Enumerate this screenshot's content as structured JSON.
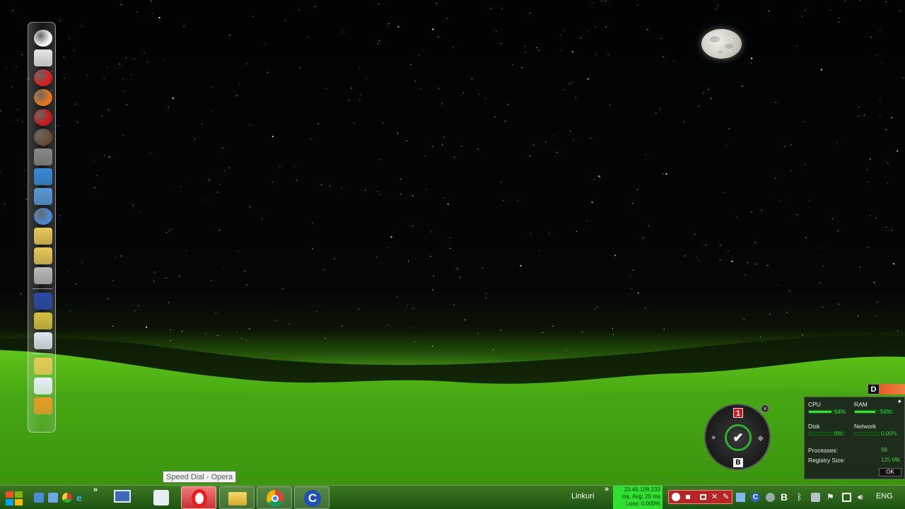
{
  "desktop": {
    "dock_item_count": 21,
    "dock_items": [
      "clock-icon",
      "notepad-icon",
      "opera-icon",
      "firefox-icon",
      "ladybug-icon",
      "coffee-icon",
      "hammer-icon",
      "network-icon",
      "folder-blue-icon",
      "globe-icon",
      "folder-icon",
      "folder-icon",
      "archive-icon",
      "separator",
      "remote-icon",
      "pen-icon",
      "recycle-bin-icon",
      "separator",
      "folder-icon",
      "word-icon",
      "cpu-meter-icon"
    ]
  },
  "sysmon": {
    "top_badge": "D",
    "cpu": {
      "label": "CPU",
      "value": "64%",
      "fill": 0.64
    },
    "ram": {
      "label": "RAM",
      "value": "54%",
      "fill": 0.54
    },
    "disk": {
      "label": "Disk",
      "value": "0%",
      "fill": 0.0
    },
    "network": {
      "label": "Network",
      "value": "0.00%",
      "fill": 0.0
    },
    "processes": {
      "label": "Processes:",
      "value": "98"
    },
    "registry": {
      "label": "Registry Size:",
      "value": "125 Mb"
    },
    "ok": "OK"
  },
  "dial": {
    "top": "1",
    "bottom": "B",
    "close": "×",
    "center": "✔"
  },
  "tooltip": "Speed Dial - Opera",
  "taskbar": {
    "chevron": "»",
    "links_label": "Linkuri",
    "net_line1": "23.45.109.233",
    "net_line2": "ms, Avg: 29 ms",
    "net_line3": "Loss: 0.000%",
    "lang": "ENG",
    "colors": {
      "opera_button": "#c83232",
      "tray_highlight": "#b82424",
      "ping_box": "#30e030"
    }
  }
}
